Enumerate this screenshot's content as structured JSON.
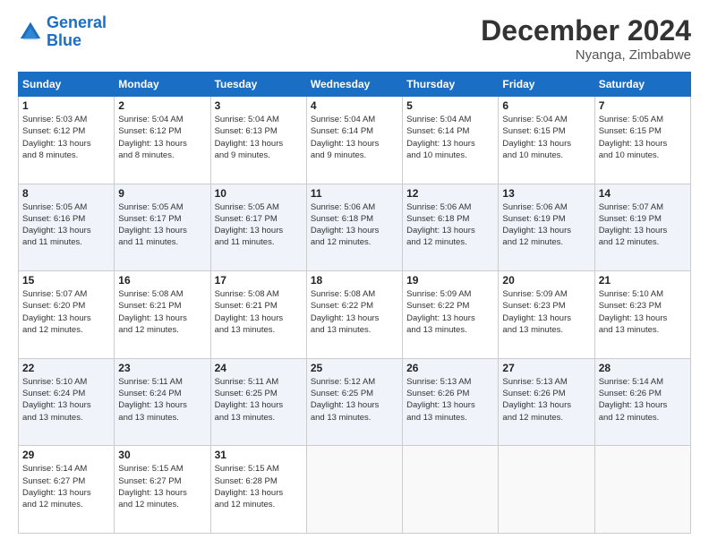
{
  "header": {
    "logo_line1": "General",
    "logo_line2": "Blue",
    "month": "December 2024",
    "location": "Nyanga, Zimbabwe"
  },
  "weekdays": [
    "Sunday",
    "Monday",
    "Tuesday",
    "Wednesday",
    "Thursday",
    "Friday",
    "Saturday"
  ],
  "weeks": [
    [
      {
        "day": "1",
        "info": "Sunrise: 5:03 AM\nSunset: 6:12 PM\nDaylight: 13 hours\nand 8 minutes."
      },
      {
        "day": "2",
        "info": "Sunrise: 5:04 AM\nSunset: 6:12 PM\nDaylight: 13 hours\nand 8 minutes."
      },
      {
        "day": "3",
        "info": "Sunrise: 5:04 AM\nSunset: 6:13 PM\nDaylight: 13 hours\nand 9 minutes."
      },
      {
        "day": "4",
        "info": "Sunrise: 5:04 AM\nSunset: 6:14 PM\nDaylight: 13 hours\nand 9 minutes."
      },
      {
        "day": "5",
        "info": "Sunrise: 5:04 AM\nSunset: 6:14 PM\nDaylight: 13 hours\nand 10 minutes."
      },
      {
        "day": "6",
        "info": "Sunrise: 5:04 AM\nSunset: 6:15 PM\nDaylight: 13 hours\nand 10 minutes."
      },
      {
        "day": "7",
        "info": "Sunrise: 5:05 AM\nSunset: 6:15 PM\nDaylight: 13 hours\nand 10 minutes."
      }
    ],
    [
      {
        "day": "8",
        "info": "Sunrise: 5:05 AM\nSunset: 6:16 PM\nDaylight: 13 hours\nand 11 minutes."
      },
      {
        "day": "9",
        "info": "Sunrise: 5:05 AM\nSunset: 6:17 PM\nDaylight: 13 hours\nand 11 minutes."
      },
      {
        "day": "10",
        "info": "Sunrise: 5:05 AM\nSunset: 6:17 PM\nDaylight: 13 hours\nand 11 minutes."
      },
      {
        "day": "11",
        "info": "Sunrise: 5:06 AM\nSunset: 6:18 PM\nDaylight: 13 hours\nand 12 minutes."
      },
      {
        "day": "12",
        "info": "Sunrise: 5:06 AM\nSunset: 6:18 PM\nDaylight: 13 hours\nand 12 minutes."
      },
      {
        "day": "13",
        "info": "Sunrise: 5:06 AM\nSunset: 6:19 PM\nDaylight: 13 hours\nand 12 minutes."
      },
      {
        "day": "14",
        "info": "Sunrise: 5:07 AM\nSunset: 6:19 PM\nDaylight: 13 hours\nand 12 minutes."
      }
    ],
    [
      {
        "day": "15",
        "info": "Sunrise: 5:07 AM\nSunset: 6:20 PM\nDaylight: 13 hours\nand 12 minutes."
      },
      {
        "day": "16",
        "info": "Sunrise: 5:08 AM\nSunset: 6:21 PM\nDaylight: 13 hours\nand 12 minutes."
      },
      {
        "day": "17",
        "info": "Sunrise: 5:08 AM\nSunset: 6:21 PM\nDaylight: 13 hours\nand 13 minutes."
      },
      {
        "day": "18",
        "info": "Sunrise: 5:08 AM\nSunset: 6:22 PM\nDaylight: 13 hours\nand 13 minutes."
      },
      {
        "day": "19",
        "info": "Sunrise: 5:09 AM\nSunset: 6:22 PM\nDaylight: 13 hours\nand 13 minutes."
      },
      {
        "day": "20",
        "info": "Sunrise: 5:09 AM\nSunset: 6:23 PM\nDaylight: 13 hours\nand 13 minutes."
      },
      {
        "day": "21",
        "info": "Sunrise: 5:10 AM\nSunset: 6:23 PM\nDaylight: 13 hours\nand 13 minutes."
      }
    ],
    [
      {
        "day": "22",
        "info": "Sunrise: 5:10 AM\nSunset: 6:24 PM\nDaylight: 13 hours\nand 13 minutes."
      },
      {
        "day": "23",
        "info": "Sunrise: 5:11 AM\nSunset: 6:24 PM\nDaylight: 13 hours\nand 13 minutes."
      },
      {
        "day": "24",
        "info": "Sunrise: 5:11 AM\nSunset: 6:25 PM\nDaylight: 13 hours\nand 13 minutes."
      },
      {
        "day": "25",
        "info": "Sunrise: 5:12 AM\nSunset: 6:25 PM\nDaylight: 13 hours\nand 13 minutes."
      },
      {
        "day": "26",
        "info": "Sunrise: 5:13 AM\nSunset: 6:26 PM\nDaylight: 13 hours\nand 13 minutes."
      },
      {
        "day": "27",
        "info": "Sunrise: 5:13 AM\nSunset: 6:26 PM\nDaylight: 13 hours\nand 12 minutes."
      },
      {
        "day": "28",
        "info": "Sunrise: 5:14 AM\nSunset: 6:26 PM\nDaylight: 13 hours\nand 12 minutes."
      }
    ],
    [
      {
        "day": "29",
        "info": "Sunrise: 5:14 AM\nSunset: 6:27 PM\nDaylight: 13 hours\nand 12 minutes."
      },
      {
        "day": "30",
        "info": "Sunrise: 5:15 AM\nSunset: 6:27 PM\nDaylight: 13 hours\nand 12 minutes."
      },
      {
        "day": "31",
        "info": "Sunrise: 5:15 AM\nSunset: 6:28 PM\nDaylight: 13 hours\nand 12 minutes."
      },
      null,
      null,
      null,
      null
    ]
  ]
}
